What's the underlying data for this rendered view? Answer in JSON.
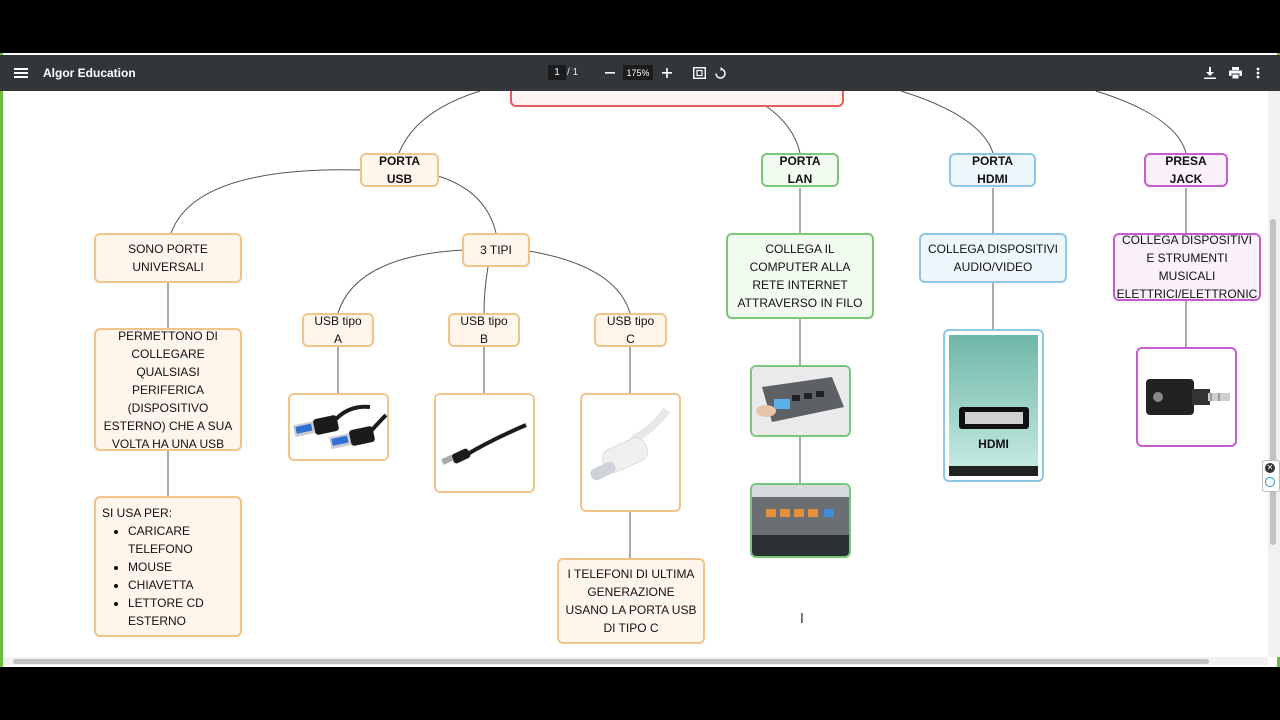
{
  "toolbar": {
    "title": "Algor Education",
    "page_current": "1",
    "page_sep": "/",
    "page_total": "1",
    "zoom": "175%",
    "icons": [
      "menu-icon",
      "zoom-out-icon",
      "zoom-in-icon",
      "fit-page-icon",
      "rotate-icon",
      "download-icon",
      "print-icon",
      "more-vert-icon"
    ]
  },
  "map": {
    "porta_usb": "PORTA USB",
    "porta_lan": "PORTA LAN",
    "porta_hdmi": "PORTA HDMI",
    "presa_jack": "PRESA JACK",
    "universali": "SONO PORTE UNIVERSALI",
    "permettono": "PERMETTONO DI COLLEGARE QUALSIASI PERIFERICA (DISPOSITIVO ESTERNO) CHE A SUA VOLTA HA UNA USB",
    "si_usa_per": "SI USA PER:",
    "usi": [
      "CARICARE TELEFONO",
      "MOUSE",
      "CHIAVETTA",
      "LETTORE CD ESTERNO"
    ],
    "tre_tipi": "3 TIPI",
    "usb_a": "USB tipo A",
    "usb_b": "USB tipo B",
    "usb_c": "USB tipo C",
    "telefoni": "I TELEFONI DI ULTIMA GENERAZIONE USANO LA PORTA USB DI TIPO C",
    "lan_desc": "COLLEGA IL COMPUTER ALLA RETE INTERNET ATTRAVERSO IN FILO",
    "hdmi_desc": "COLLEGA DISPOSITIVI AUDIO/VIDEO",
    "jack_desc": "COLLEGA DISPOSITIVI E STRUMENTI MUSICALI ELETTRICI/ELETTRONIC",
    "hdmi_label": "HDMI"
  },
  "colors": {
    "orange": "#f3c48a",
    "green": "#79c77b",
    "blue": "#8cc7e5",
    "purple": "#c65ccf",
    "red": "#e06060"
  }
}
